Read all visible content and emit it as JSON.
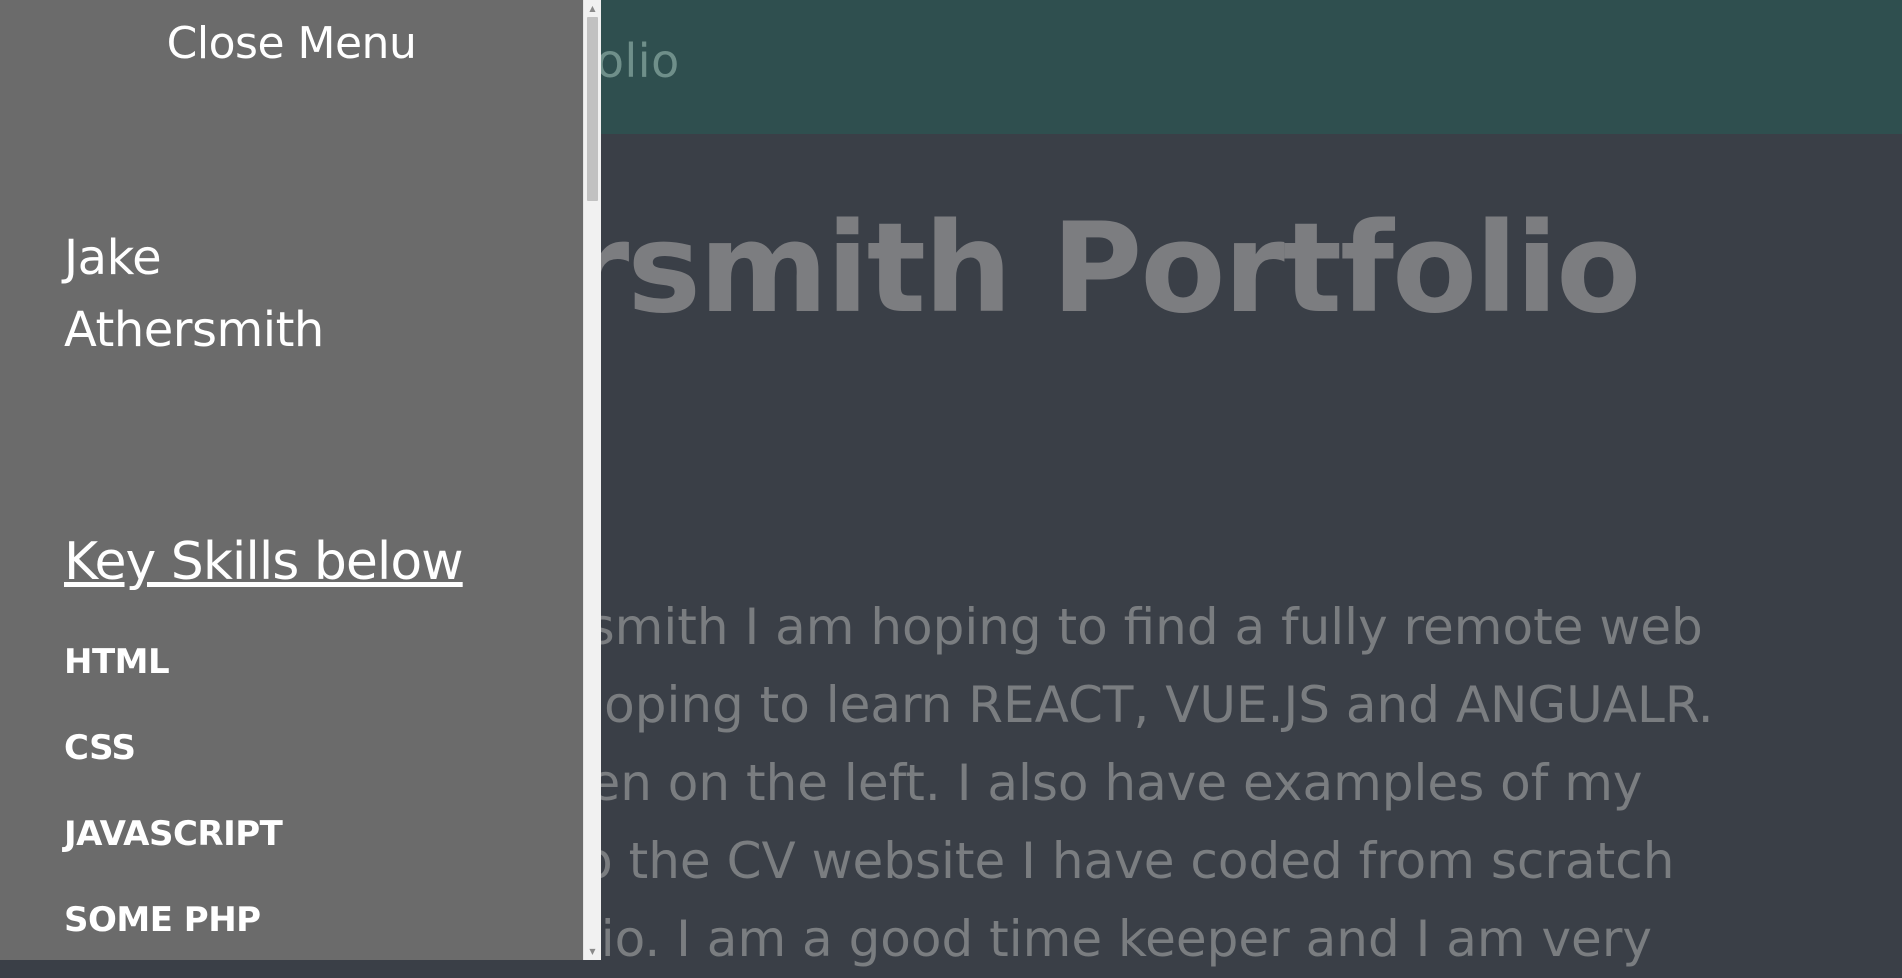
{
  "header": {
    "title": "Portfolio"
  },
  "hero": {
    "title": "ersmith Portfolio"
  },
  "intro": {
    "lines": [
      "thersmith I am hoping to find a fully remote web",
      "lso hoping to learn REACT, VUE.JS and ANGUALR.",
      "e seen on the left. I also have examples of my",
      "nk to the CV website I have coded from scratch",
      " Studio. I am a good time keeper and I am very"
    ]
  },
  "sidenav": {
    "close_label": "Close Menu",
    "name_line1": "Jake",
    "name_line2": "Athersmith",
    "skills_heading": "Key Skills below",
    "skills": [
      "HTML",
      "CSS",
      "JAVASCRIPT",
      "SOME PHP"
    ]
  },
  "colors": {
    "sidenav_bg": "#6b6b6b",
    "topbar_bg": "#2f4f4f",
    "page_bg": "#3a3f47"
  }
}
